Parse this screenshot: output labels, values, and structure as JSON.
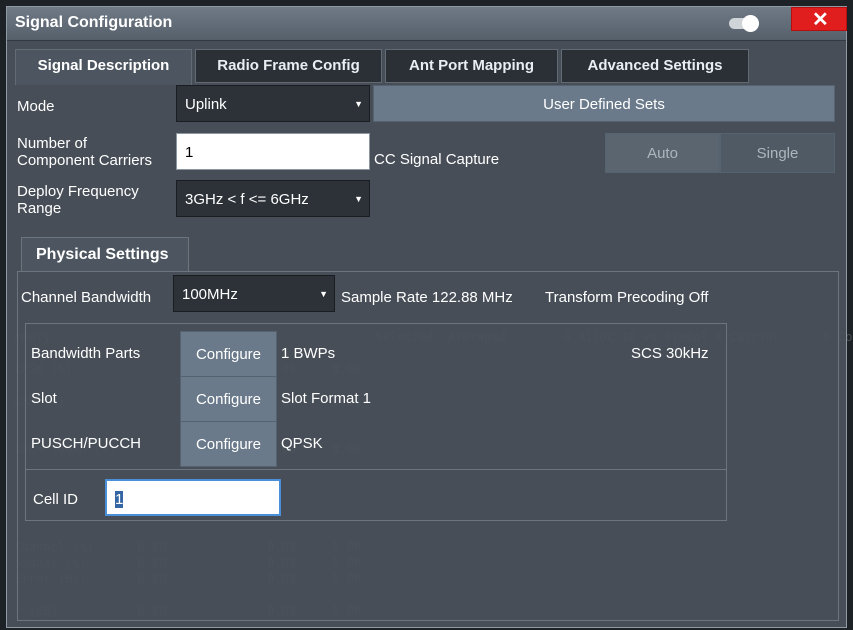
{
  "dialog": {
    "title": "Signal Configuration",
    "close_label": "✕"
  },
  "tabs": [
    {
      "label": "Signal Description",
      "active": true
    },
    {
      "label": "Radio Frame Config",
      "active": false
    },
    {
      "label": "Ant Port Mapping",
      "active": false
    },
    {
      "label": "Advanced Settings",
      "active": false
    }
  ],
  "mode": {
    "label": "Mode",
    "value": "Uplink",
    "user_defined_sets": "User Defined Sets"
  },
  "component_carriers": {
    "label_line1": "Number of",
    "label_line2": "Component Carriers",
    "value": "1",
    "cc_capture_label": "CC Signal Capture",
    "auto_label": "Auto",
    "single_label": "Single"
  },
  "deploy_freq": {
    "label_line1": "Deploy Frequency",
    "label_line2": "Range",
    "value": "3GHz < f <= 6GHz"
  },
  "physical": {
    "tab_label": "Physical Settings",
    "channel_bandwidth_label": "Channel Bandwidth",
    "channel_bandwidth_value": "100MHz",
    "sample_rate": "Sample Rate 122.88 MHz",
    "transform_precoding": "Transform Precoding Off",
    "bandwidth_parts_label": "Bandwidth Parts",
    "bwp_configure": "Configure",
    "bwp_value": "1 BWPs",
    "scs_value": "SCS 30kHz",
    "slot_label": "Slot",
    "slot_configure": "Configure",
    "slot_value": "Slot Format 1",
    "pusch_label": "PUSCH/PUCCH",
    "pusch_configure": "Configure",
    "pusch_value": "QPSK",
    "cell_id_label": "Cell ID",
    "cell_id_value": "1"
  },
  "colors": {
    "accent": "#6a7a8b",
    "close": "#e01e1e",
    "dialog_bg": "#4a525b"
  }
}
